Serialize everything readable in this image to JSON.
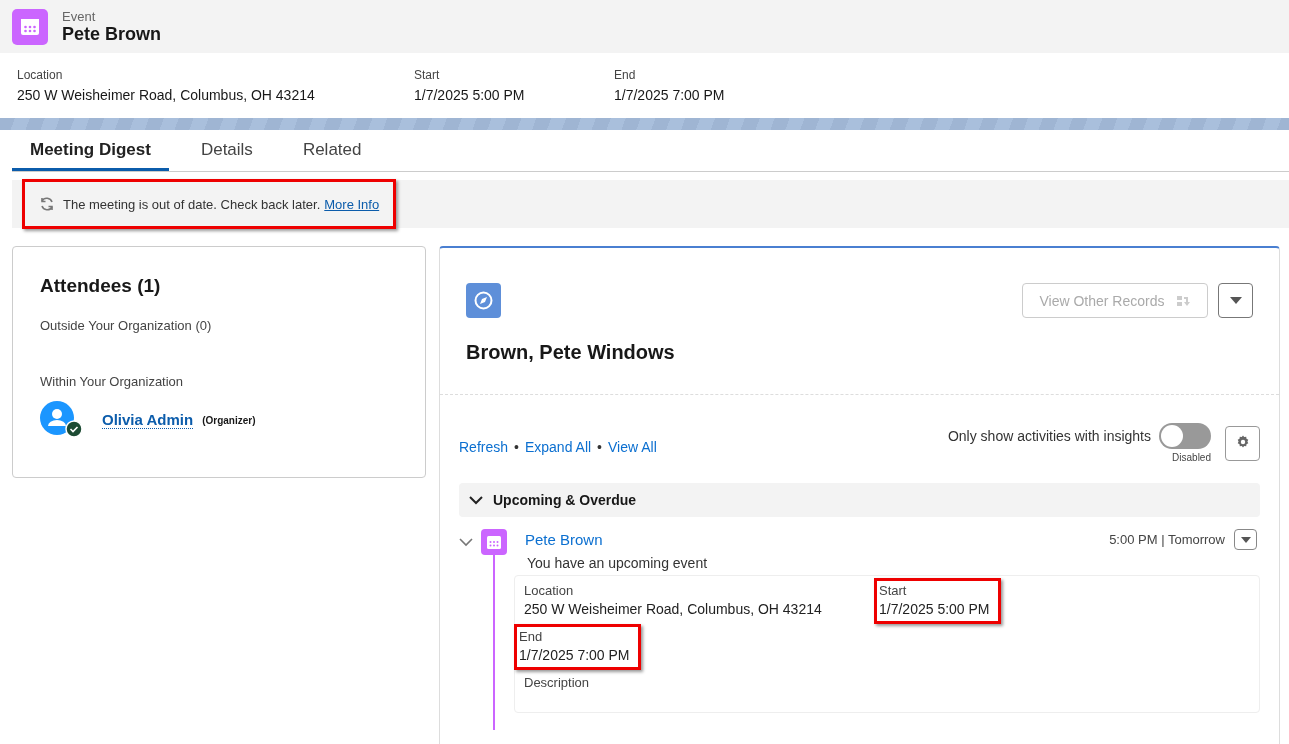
{
  "record": {
    "type": "Event",
    "title": "Pete Brown"
  },
  "fields": [
    {
      "label": "Location",
      "value": "250 W Weisheimer Road, Columbus, OH 43214"
    },
    {
      "label": "Start",
      "value": "1/7/2025 5:00 PM"
    },
    {
      "label": "End",
      "value": "1/7/2025 7:00 PM"
    }
  ],
  "tabs": [
    {
      "label": "Meeting Digest",
      "selected": true
    },
    {
      "label": "Details",
      "selected": false
    },
    {
      "label": "Related",
      "selected": false
    }
  ],
  "banner": {
    "text": "The meeting is out of date. Check back later.",
    "link": "More Info",
    "highlighted": true
  },
  "attendees": {
    "title": "Attendees (1)",
    "outside": "Outside Your Organization (0)",
    "within": "Within Your Organization",
    "people": [
      {
        "name": "Olivia Admin",
        "role": "(Organizer)"
      }
    ]
  },
  "contact": {
    "name": "Brown, Pete Windows",
    "view_button": "View Other Records",
    "view_button_disabled": true,
    "links": [
      "Refresh",
      "Expand All",
      "View All"
    ],
    "link_separator": "•",
    "toggle": {
      "label": "Only show activities with insights",
      "on": false,
      "status": "Disabled"
    }
  },
  "timeline": {
    "section": "Upcoming & Overdue",
    "expanded": true,
    "items": [
      {
        "title": "Pete Brown",
        "subtitle": "You have an upcoming event",
        "time": "5:00 PM | Tomorrow",
        "expanded": true,
        "details": [
          {
            "label": "Location",
            "value": "250 W Weisheimer Road, Columbus, OH 43214",
            "highlighted": false
          },
          {
            "label": "Start",
            "value": "1/7/2025 5:00 PM",
            "highlighted": true
          },
          {
            "label": "End",
            "value": "1/7/2025 7:00 PM",
            "highlighted": true
          },
          {
            "label": "Description",
            "highlighted": false
          }
        ]
      }
    ]
  }
}
